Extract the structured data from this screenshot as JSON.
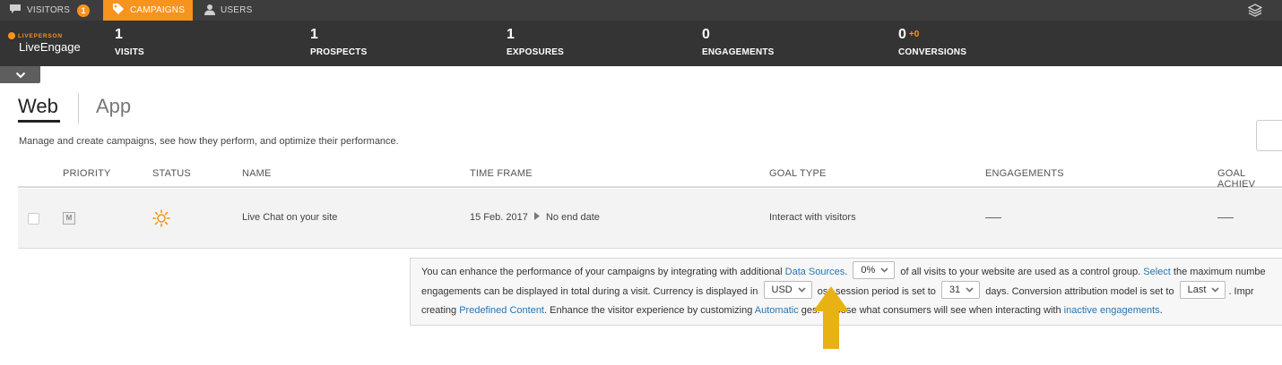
{
  "topnav": {
    "tabs": [
      {
        "label": "VISITORS",
        "icon": "chat-bubble-icon",
        "badge": "1"
      },
      {
        "label": "CAMPAIGNS",
        "icon": "tag-icon",
        "active": true
      },
      {
        "label": "USERS",
        "icon": "user-icon"
      }
    ],
    "right_icon": "layers-icon"
  },
  "brand": {
    "top": "LIVEPERSON",
    "main": "LiveEngage"
  },
  "stats": [
    {
      "value": "1",
      "label": "VISITS"
    },
    {
      "value": "1",
      "label": "PROSPECTS"
    },
    {
      "value": "1",
      "label": "EXPOSURES"
    },
    {
      "value": "0",
      "label": "ENGAGEMENTS"
    },
    {
      "value": "0",
      "delta": "+0",
      "label": "CONVERSIONS"
    }
  ],
  "channels": {
    "web": "Web",
    "app": "App"
  },
  "subtitle": "Manage and create campaigns, see how they perform, and optimize their performance.",
  "table": {
    "headers": [
      "PRIORITY",
      "STATUS",
      "NAME",
      "TIME FRAME",
      "GOAL TYPE",
      "ENGAGEMENTS",
      "GOAL ACHIEV"
    ],
    "rows": [
      {
        "priority": "M",
        "status_icon": "sun-icon",
        "name": "Live Chat on your site",
        "start": "15 Feb. 2017",
        "end": "No end date",
        "goal_type": "Interact with visitors"
      }
    ]
  },
  "info": {
    "l1a": "You can enhance the performance of your campaigns by integrating with additional",
    "l1_link": "Data Sources",
    "l1_sel": "0%",
    "l1b": "of all visits to your website are used as a control group.",
    "l1_link2": "Select",
    "l1c": "the maximum numbe",
    "l2a": "engagements can be displayed in total during a visit. Currency is displayed in",
    "l2_sel1": "USD",
    "l2b": "oss session period is set to",
    "l2_sel2": "31",
    "l2c": "days. Conversion attribution model is set to",
    "l2_sel3": "Last",
    "l2d": ". Impr",
    "l3a": "creating",
    "l3_link1": "Predefined Content",
    "l3b": ". Enhance the visitor experience by customizing",
    "l3_link2": "Automatic",
    "l3c": "ges. Choose what consumers will see when interacting with",
    "l3_link3": "inactive engagements",
    "l3d": "."
  },
  "colors": {
    "accent": "#f7941d",
    "link": "#2476b7",
    "arrow": "#e8b114"
  }
}
